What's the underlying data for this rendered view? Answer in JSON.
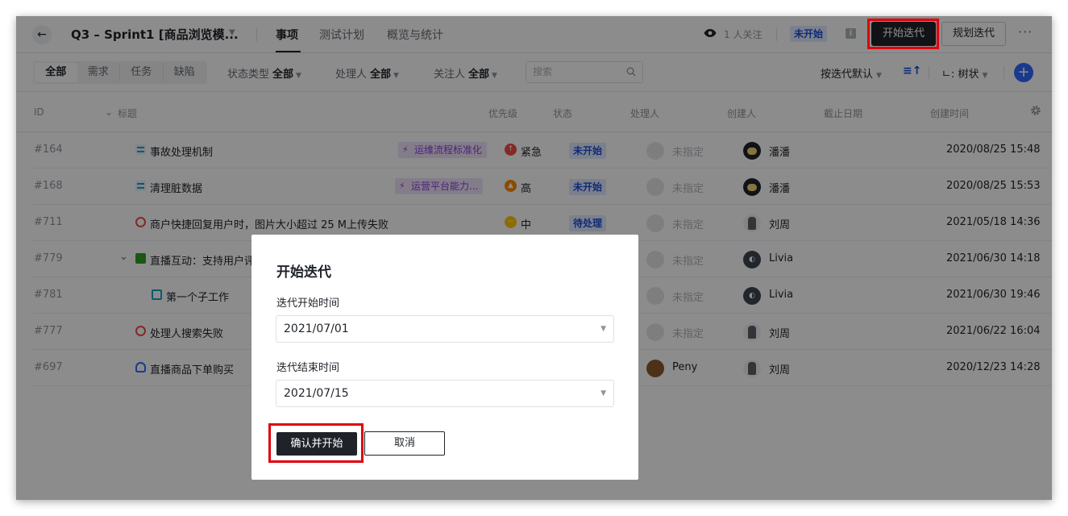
{
  "header": {
    "back_icon": "arrow-left-icon",
    "project_title": "Q3 – Sprint1 [商品浏览模...",
    "tabs": [
      {
        "label": "事项",
        "active": true
      },
      {
        "label": "测试计划",
        "active": false
      },
      {
        "label": "概览与统计",
        "active": false
      }
    ],
    "followers": "1 人关注",
    "status_badge": "未开始",
    "start_button": "开始迭代",
    "plan_button": "规划迭代",
    "more_icon": "ellipsis-icon"
  },
  "toolbar": {
    "segments": [
      {
        "label": "全部",
        "active": true
      },
      {
        "label": "需求",
        "active": false
      },
      {
        "label": "任务",
        "active": false
      },
      {
        "label": "缺陷",
        "active": false
      }
    ],
    "filters": [
      {
        "label": "状态类型",
        "value": "全部"
      },
      {
        "label": "处理人",
        "value": "全部"
      },
      {
        "label": "关注人",
        "value": "全部"
      }
    ],
    "search_placeholder": "搜索",
    "sort_label": "按迭代默认",
    "view_label": "树状"
  },
  "table": {
    "columns": [
      "ID",
      "标题",
      "优先级",
      "状态",
      "处理人",
      "创建人",
      "截止日期",
      "创建时间"
    ],
    "rows": [
      {
        "id": "#164",
        "type": "story",
        "title": "事故处理机制",
        "tag": "运维流程标准化",
        "priority": "紧急",
        "priority_color": "#f54a45",
        "status": "未开始",
        "assignee": "未指定",
        "assignee_avatar": "empty",
        "creator": "潘潘",
        "creator_avatar": "panda",
        "due": "",
        "created": "2020/08/25 15:48"
      },
      {
        "id": "#168",
        "type": "story",
        "title": "清理脏数据",
        "tag": "运营平台能力...",
        "priority": "高",
        "priority_color": "#ff8800",
        "status": "未开始",
        "assignee": "未指定",
        "assignee_avatar": "empty",
        "creator": "潘潘",
        "creator_avatar": "panda",
        "due": "",
        "created": "2020/08/25 15:53"
      },
      {
        "id": "#711",
        "type": "bug",
        "title": "商户快捷回复用户时，图片大小超过 25 M上传失败",
        "tag": "",
        "priority": "中",
        "priority_color": "#ffc60a",
        "status": "待处理",
        "assignee": "未指定",
        "assignee_avatar": "empty",
        "creator": "刘周",
        "creator_avatar": "liu",
        "due": "",
        "created": "2021/05/18 14:36"
      },
      {
        "id": "#779",
        "type": "req",
        "title": "直播互动：支持用户评论",
        "tag": "",
        "priority": "",
        "priority_color": "",
        "status": "",
        "assignee": "未指定",
        "assignee_avatar": "empty",
        "creator": "Livia",
        "creator_avatar": "livia",
        "due": "",
        "created": "2021/06/30 14:18"
      },
      {
        "id": "#781",
        "type": "sub",
        "title": "第一个子工作",
        "tag": "",
        "priority": "",
        "priority_color": "",
        "status": "",
        "assignee": "未指定",
        "assignee_avatar": "empty",
        "creator": "Livia",
        "creator_avatar": "livia",
        "due": "",
        "created": "2021/06/30 19:46"
      },
      {
        "id": "#777",
        "type": "bug",
        "title": "处理人搜索失败",
        "tag": "",
        "priority": "",
        "priority_color": "",
        "status": "",
        "assignee": "未指定",
        "assignee_avatar": "empty",
        "creator": "刘周",
        "creator_avatar": "liu",
        "due": "",
        "created": "2021/06/22 16:04"
      },
      {
        "id": "#697",
        "type": "idea",
        "title": "直播商品下单购买",
        "tag": "",
        "priority": "",
        "priority_color": "",
        "status": "",
        "assignee": "Peny",
        "assignee_avatar": "peny",
        "creator": "刘周",
        "creator_avatar": "liu",
        "due": "",
        "created": "2020/12/23 14:28"
      }
    ]
  },
  "modal": {
    "title": "开始迭代",
    "start_label": "迭代开始时间",
    "start_value": "2021/07/01",
    "end_label": "迭代结束时间",
    "end_value": "2021/07/15",
    "confirm_button": "确认并开始",
    "cancel_button": "取消"
  },
  "colors": {
    "accent": "#1f2329",
    "primary_blue": "#2f6bff",
    "highlight_frame": "#e0000a"
  }
}
